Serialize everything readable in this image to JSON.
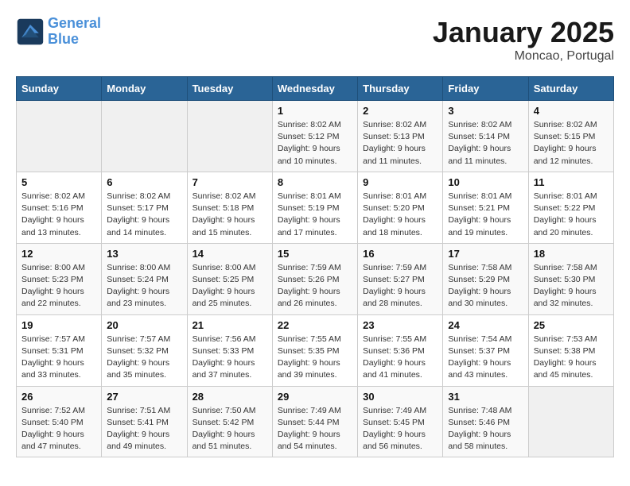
{
  "header": {
    "logo_line1": "General",
    "logo_line2": "Blue",
    "month": "January 2025",
    "location": "Moncao, Portugal"
  },
  "weekdays": [
    "Sunday",
    "Monday",
    "Tuesday",
    "Wednesday",
    "Thursday",
    "Friday",
    "Saturday"
  ],
  "weeks": [
    [
      {
        "day": "",
        "info": ""
      },
      {
        "day": "",
        "info": ""
      },
      {
        "day": "",
        "info": ""
      },
      {
        "day": "1",
        "info": "Sunrise: 8:02 AM\nSunset: 5:12 PM\nDaylight: 9 hours\nand 10 minutes."
      },
      {
        "day": "2",
        "info": "Sunrise: 8:02 AM\nSunset: 5:13 PM\nDaylight: 9 hours\nand 11 minutes."
      },
      {
        "day": "3",
        "info": "Sunrise: 8:02 AM\nSunset: 5:14 PM\nDaylight: 9 hours\nand 11 minutes."
      },
      {
        "day": "4",
        "info": "Sunrise: 8:02 AM\nSunset: 5:15 PM\nDaylight: 9 hours\nand 12 minutes."
      }
    ],
    [
      {
        "day": "5",
        "info": "Sunrise: 8:02 AM\nSunset: 5:16 PM\nDaylight: 9 hours\nand 13 minutes."
      },
      {
        "day": "6",
        "info": "Sunrise: 8:02 AM\nSunset: 5:17 PM\nDaylight: 9 hours\nand 14 minutes."
      },
      {
        "day": "7",
        "info": "Sunrise: 8:02 AM\nSunset: 5:18 PM\nDaylight: 9 hours\nand 15 minutes."
      },
      {
        "day": "8",
        "info": "Sunrise: 8:01 AM\nSunset: 5:19 PM\nDaylight: 9 hours\nand 17 minutes."
      },
      {
        "day": "9",
        "info": "Sunrise: 8:01 AM\nSunset: 5:20 PM\nDaylight: 9 hours\nand 18 minutes."
      },
      {
        "day": "10",
        "info": "Sunrise: 8:01 AM\nSunset: 5:21 PM\nDaylight: 9 hours\nand 19 minutes."
      },
      {
        "day": "11",
        "info": "Sunrise: 8:01 AM\nSunset: 5:22 PM\nDaylight: 9 hours\nand 20 minutes."
      }
    ],
    [
      {
        "day": "12",
        "info": "Sunrise: 8:00 AM\nSunset: 5:23 PM\nDaylight: 9 hours\nand 22 minutes."
      },
      {
        "day": "13",
        "info": "Sunrise: 8:00 AM\nSunset: 5:24 PM\nDaylight: 9 hours\nand 23 minutes."
      },
      {
        "day": "14",
        "info": "Sunrise: 8:00 AM\nSunset: 5:25 PM\nDaylight: 9 hours\nand 25 minutes."
      },
      {
        "day": "15",
        "info": "Sunrise: 7:59 AM\nSunset: 5:26 PM\nDaylight: 9 hours\nand 26 minutes."
      },
      {
        "day": "16",
        "info": "Sunrise: 7:59 AM\nSunset: 5:27 PM\nDaylight: 9 hours\nand 28 minutes."
      },
      {
        "day": "17",
        "info": "Sunrise: 7:58 AM\nSunset: 5:29 PM\nDaylight: 9 hours\nand 30 minutes."
      },
      {
        "day": "18",
        "info": "Sunrise: 7:58 AM\nSunset: 5:30 PM\nDaylight: 9 hours\nand 32 minutes."
      }
    ],
    [
      {
        "day": "19",
        "info": "Sunrise: 7:57 AM\nSunset: 5:31 PM\nDaylight: 9 hours\nand 33 minutes."
      },
      {
        "day": "20",
        "info": "Sunrise: 7:57 AM\nSunset: 5:32 PM\nDaylight: 9 hours\nand 35 minutes."
      },
      {
        "day": "21",
        "info": "Sunrise: 7:56 AM\nSunset: 5:33 PM\nDaylight: 9 hours\nand 37 minutes."
      },
      {
        "day": "22",
        "info": "Sunrise: 7:55 AM\nSunset: 5:35 PM\nDaylight: 9 hours\nand 39 minutes."
      },
      {
        "day": "23",
        "info": "Sunrise: 7:55 AM\nSunset: 5:36 PM\nDaylight: 9 hours\nand 41 minutes."
      },
      {
        "day": "24",
        "info": "Sunrise: 7:54 AM\nSunset: 5:37 PM\nDaylight: 9 hours\nand 43 minutes."
      },
      {
        "day": "25",
        "info": "Sunrise: 7:53 AM\nSunset: 5:38 PM\nDaylight: 9 hours\nand 45 minutes."
      }
    ],
    [
      {
        "day": "26",
        "info": "Sunrise: 7:52 AM\nSunset: 5:40 PM\nDaylight: 9 hours\nand 47 minutes."
      },
      {
        "day": "27",
        "info": "Sunrise: 7:51 AM\nSunset: 5:41 PM\nDaylight: 9 hours\nand 49 minutes."
      },
      {
        "day": "28",
        "info": "Sunrise: 7:50 AM\nSunset: 5:42 PM\nDaylight: 9 hours\nand 51 minutes."
      },
      {
        "day": "29",
        "info": "Sunrise: 7:49 AM\nSunset: 5:44 PM\nDaylight: 9 hours\nand 54 minutes."
      },
      {
        "day": "30",
        "info": "Sunrise: 7:49 AM\nSunset: 5:45 PM\nDaylight: 9 hours\nand 56 minutes."
      },
      {
        "day": "31",
        "info": "Sunrise: 7:48 AM\nSunset: 5:46 PM\nDaylight: 9 hours\nand 58 minutes."
      },
      {
        "day": "",
        "info": ""
      }
    ]
  ]
}
